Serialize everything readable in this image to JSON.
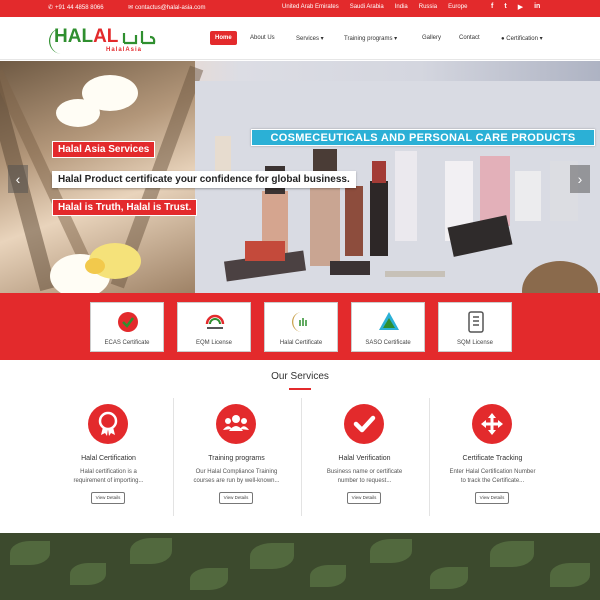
{
  "topbar": {
    "phone": "+91 44 4858 8066",
    "email": "contactus@halal-asia.com",
    "regions": [
      "United Arab Emirates",
      "Saudi Arabia",
      "India",
      "Russia",
      "Europe"
    ],
    "social": [
      "facebook-icon",
      "twitter-icon",
      "youtube-icon",
      "linkedin-icon"
    ],
    "social_glyphs": [
      "f",
      "t",
      "▶",
      "in"
    ]
  },
  "logo": {
    "brand_green": "HAL",
    "brand_red": "AL",
    "sub": "HalalAsia"
  },
  "nav": {
    "items": [
      "Home",
      "About Us",
      "Services ▾",
      "Training programs ▾",
      "Gallery",
      "Contact",
      "● Certification ▾"
    ]
  },
  "hero": {
    "banner": "COSMECEUTICALS AND PERSONAL CARE PRODUCTS",
    "tag1": "Halal Asia Services",
    "tag2": "Halal Product certificate your confidence for global business.",
    "tag3": "Halal is Truth, Halal is Trust.",
    "prev": "‹",
    "next": "›"
  },
  "certificates": [
    {
      "label": "ECAS Certificate"
    },
    {
      "label": "EQM License"
    },
    {
      "label": "Halal Certificate"
    },
    {
      "label": "SASO Certificate"
    },
    {
      "label": "SQM License"
    }
  ],
  "services": {
    "title": "Our Services",
    "items": [
      {
        "name": "Halal Certification",
        "desc1": "Halal certification is a",
        "desc2": "requirement of importing...",
        "button": "View Details",
        "icon": "certificate-badge-icon"
      },
      {
        "name": "Training programs",
        "desc1": "Our Halal Compliance Training",
        "desc2": "courses are run by well-known...",
        "button": "View Details",
        "icon": "group-users-icon"
      },
      {
        "name": "Halal Verification",
        "desc1": "Business name or certificate",
        "desc2": "number to request...",
        "button": "View Details",
        "icon": "checkmark-icon"
      },
      {
        "name": "Certificate Tracking",
        "desc1": "Enter Halal Certification Number",
        "desc2": "to track the Certificate...",
        "button": "View Details",
        "icon": "move-arrows-icon"
      }
    ]
  },
  "colors": {
    "accent": "#e32a2c",
    "banner": "#2bb0d6",
    "brand_green": "#2f8f2f"
  }
}
